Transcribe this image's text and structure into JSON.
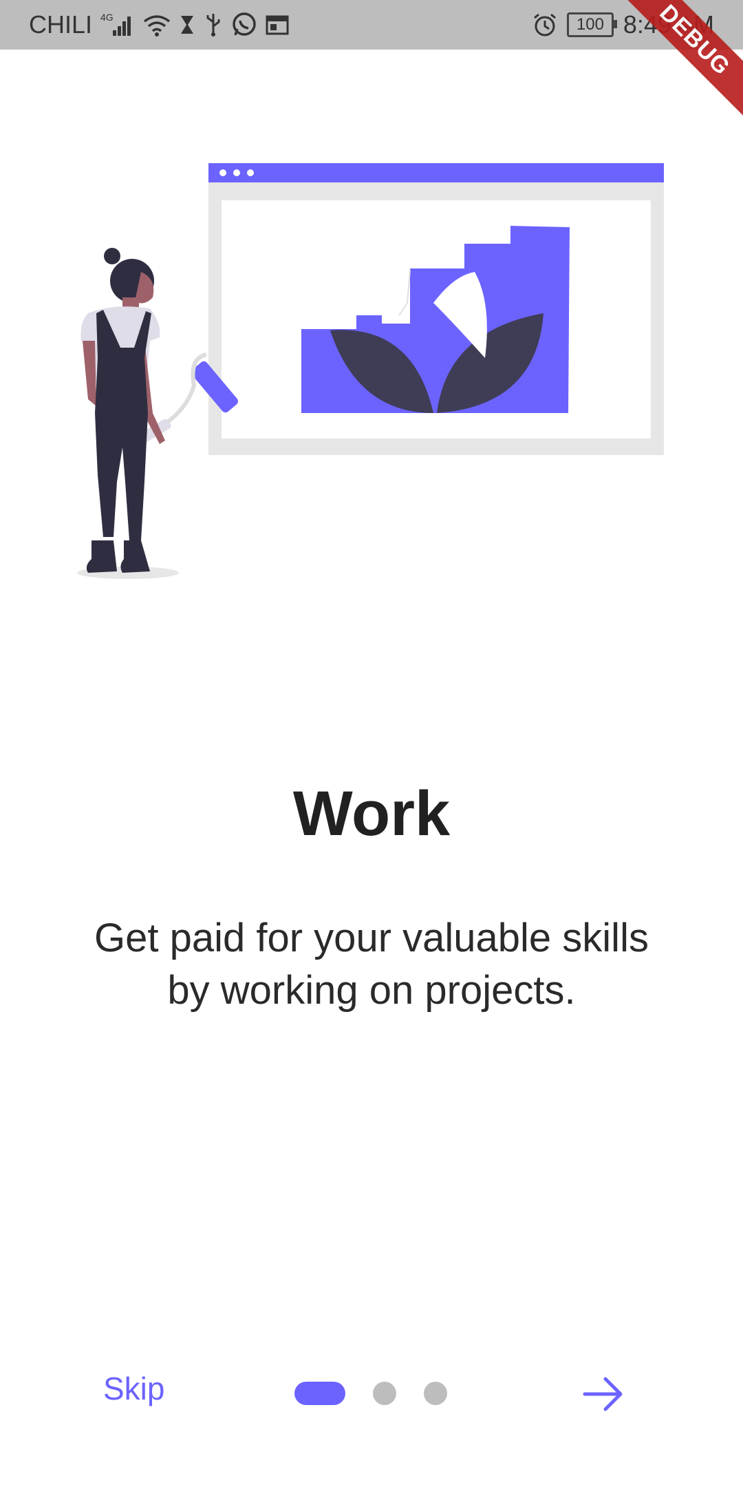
{
  "status_bar": {
    "carrier": "CHILI",
    "network": "4G",
    "battery": "100",
    "time": "8:49 AM",
    "icons": [
      "signal-icon",
      "wifi-icon",
      "hourglass-icon",
      "usb-icon",
      "whatsapp-icon",
      "calendar-icon",
      "alarm-icon",
      "battery-icon"
    ]
  },
  "debug_banner": "DEBUG",
  "onboarding": {
    "title": "Work",
    "description": "Get paid for your valuable skills by working on projects."
  },
  "nav": {
    "skip_label": "Skip",
    "page_indicator": {
      "current": 1,
      "total": 3
    },
    "next_icon": "arrow-right-icon"
  },
  "colors": {
    "accent": "#6c63ff",
    "dark": "#3f3d56",
    "inactive_dot": "#bdbdbd",
    "status_bar": "#bdbdbd",
    "debug_ribbon": "#b71c1c"
  }
}
